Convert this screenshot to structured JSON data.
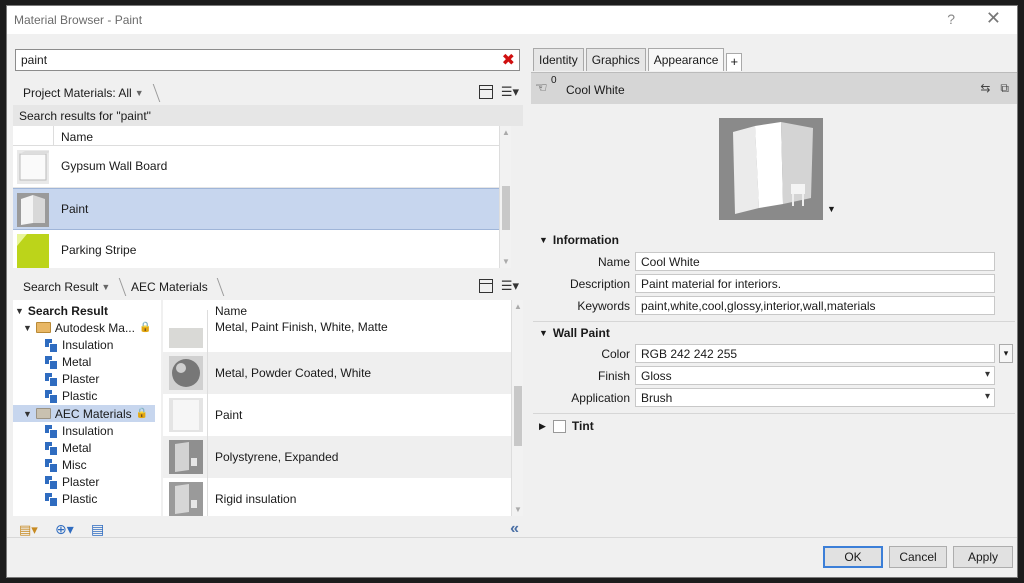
{
  "window": {
    "title": "Material Browser - Paint",
    "help_glyph": "?",
    "close_glyph": "✕"
  },
  "search": {
    "value": "paint",
    "clear_glyph": "✖"
  },
  "project": {
    "filter_label": "Project Materials: All",
    "results_label": "Search results for \"paint\"",
    "column_name": "Name",
    "items": [
      {
        "label": "Gypsum Wall Board",
        "selected": false
      },
      {
        "label": "Paint",
        "selected": true
      },
      {
        "label": "Parking Stripe",
        "selected": false
      }
    ]
  },
  "library": {
    "crumb1": "Search Result",
    "crumb2": "AEC Materials",
    "column_name": "Name",
    "tree": {
      "root": "Search Result",
      "autodesk": "Autodesk Ma...",
      "autodesk_children": [
        "Insulation",
        "Metal",
        "Plaster",
        "Plastic"
      ],
      "aec": "AEC Materials",
      "aec_children": [
        "Insulation",
        "Metal",
        "Misc",
        "Plaster",
        "Plastic"
      ]
    },
    "items": [
      "Metal, Paint Finish, White, Matte",
      "Metal, Powder Coated, White",
      "Paint",
      "Polystyrene,  Expanded",
      "Rigid insulation"
    ]
  },
  "tabs": [
    "Identity",
    "Graphics",
    "Appearance"
  ],
  "active_tab": "Appearance",
  "asset": {
    "name": "Cool White",
    "usage_count": "0"
  },
  "information": {
    "header": "Information",
    "name_label": "Name",
    "name_value": "Cool White",
    "description_label": "Description",
    "description_value": "Paint material for interiors.",
    "keywords_label": "Keywords",
    "keywords_value": "paint,white,cool,glossy,interior,wall,materials"
  },
  "wall_paint": {
    "header": "Wall Paint",
    "color_label": "Color",
    "color_value": "RGB 242 242 255",
    "finish_label": "Finish",
    "finish_value": "Gloss",
    "application_label": "Application",
    "application_value": "Brush"
  },
  "tint": {
    "header": "Tint"
  },
  "buttons": {
    "ok": "OK",
    "cancel": "Cancel",
    "apply": "Apply"
  },
  "colors": {
    "selection": "#c7d6ee",
    "accent": "#3c7fd8",
    "clear": "#d01010",
    "folder": "#e8b765",
    "library": "#2f6cc0"
  }
}
